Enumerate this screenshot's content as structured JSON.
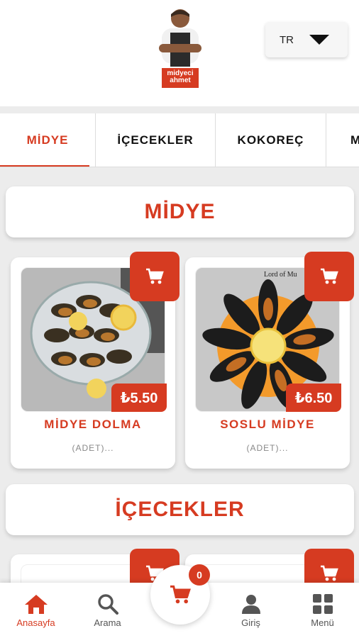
{
  "brand": {
    "logo_text_line1": "midyeci",
    "logo_text_line2": "ahmet"
  },
  "language": {
    "selected": "TR"
  },
  "tabs": [
    {
      "label": "MİDYE"
    },
    {
      "label": "İÇECEKLER"
    },
    {
      "label": "KOKOREÇ"
    },
    {
      "label": "M"
    }
  ],
  "sections": [
    {
      "title": "MİDYE",
      "products": [
        {
          "name": "MİDYE DOLMA",
          "price": "₺5.50",
          "desc": "(ADET)..."
        },
        {
          "name": "SOSLU MİDYE",
          "price": "₺6.50",
          "desc": "(ADET)...",
          "image_caption": "Lord of Mu"
        }
      ]
    },
    {
      "title": "İÇECEKLER"
    }
  ],
  "cart": {
    "count": "0"
  },
  "bottom_nav": [
    {
      "label": "Anasayfa"
    },
    {
      "label": "Arama"
    },
    {
      "label": "Giriş"
    },
    {
      "label": "Menü"
    }
  ],
  "colors": {
    "accent": "#d63b21",
    "background": "#ececec"
  }
}
